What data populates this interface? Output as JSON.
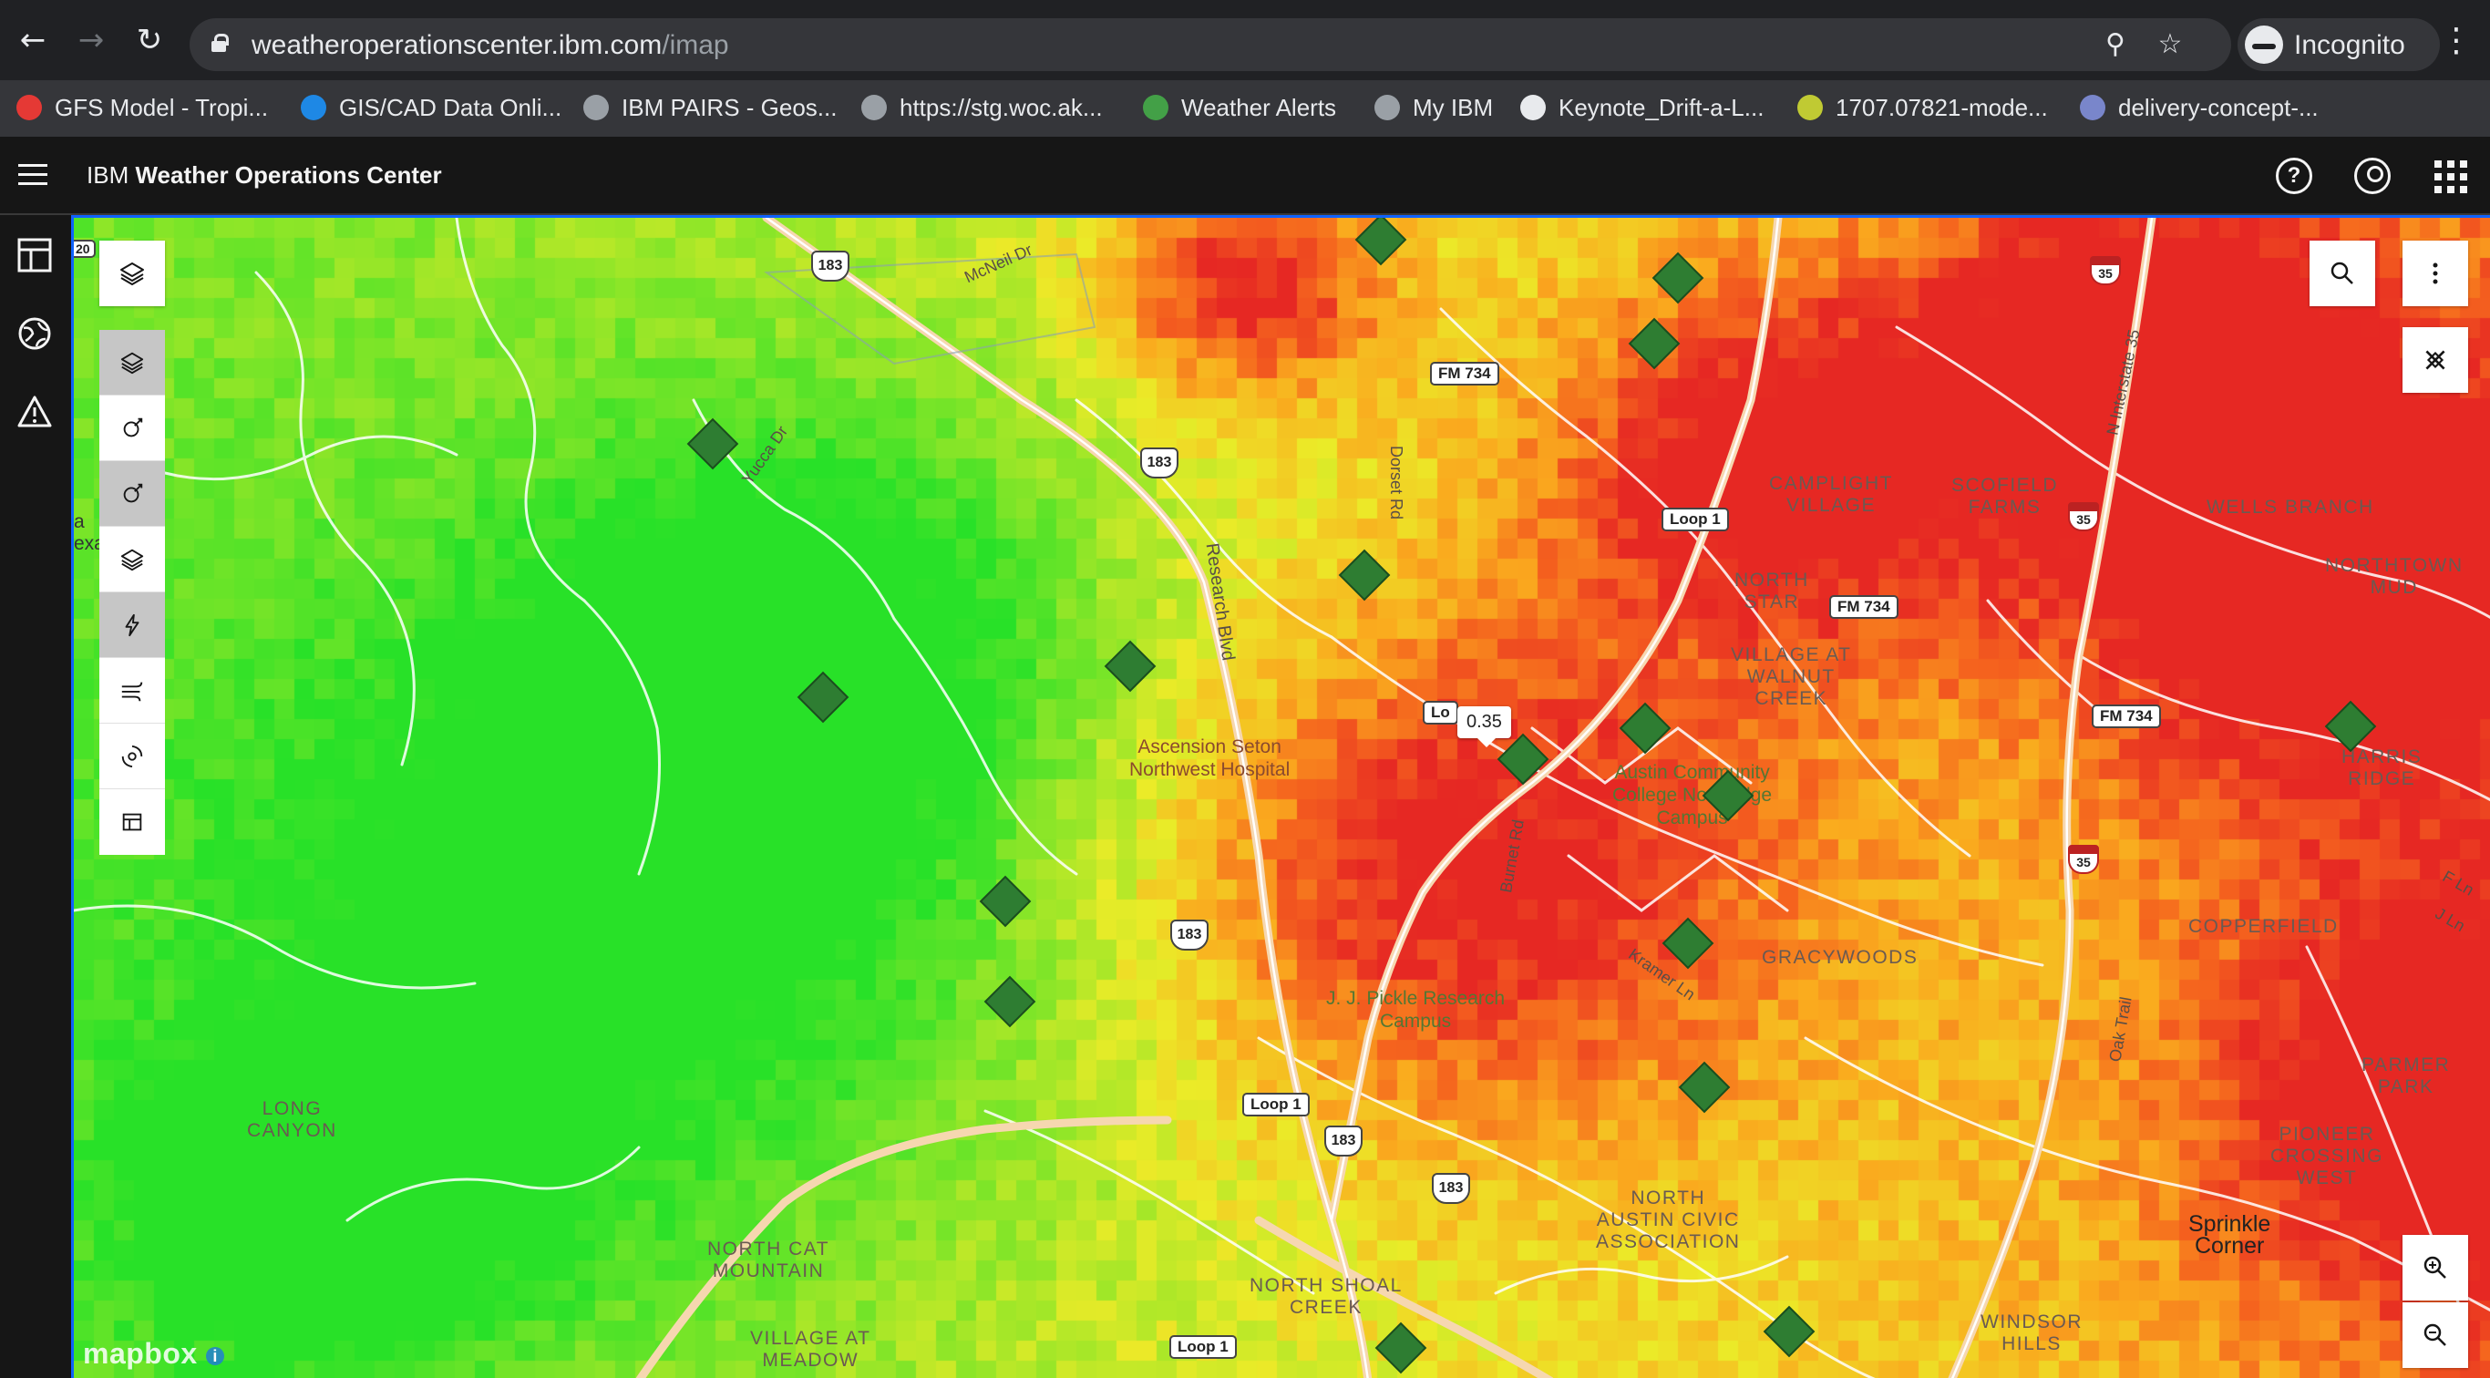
{
  "browser": {
    "url_host": "weatheroperationscenter.ibm.com",
    "url_path": "/imap",
    "profile_label": "Incognito"
  },
  "bookmarks": [
    {
      "label": "GFS Model - Tropi...",
      "color": "#e53935"
    },
    {
      "label": "GIS/CAD Data Onli...",
      "color": "#1e88e5"
    },
    {
      "label": "IBM PAIRS - Geos...",
      "color": "#9aa0a6"
    },
    {
      "label": "https://stg.woc.ak...",
      "color": "#9aa0a6"
    },
    {
      "label": "Weather Alerts",
      "color": "#43a047"
    },
    {
      "label": "My IBM",
      "color": "#9aa0a6"
    },
    {
      "label": "Keynote_Drift-a-L...",
      "color": "#e8eaed"
    },
    {
      "label": "1707.07821-mode...",
      "color": "#c0ca33"
    },
    {
      "label": "delivery-concept-...",
      "color": "#7986cb"
    }
  ],
  "app": {
    "brand": "IBM",
    "title": "Weather Operations Center"
  },
  "map": {
    "tooltip_value": "0.35",
    "attribution": "mapbox",
    "area_labels": [
      {
        "text": "LONG\nCANYON"
      },
      {
        "text": "NORTH CAT\nMOUNTAIN"
      },
      {
        "text": "VILLAGE AT\nMEADOW"
      },
      {
        "text": "CAMPLIGHT\nVILLAGE"
      },
      {
        "text": "SCOFIELD\nFARMS"
      },
      {
        "text": "NORTH\nSTAR"
      },
      {
        "text": "VILLAGE AT\nWALNUT\nCREEK"
      },
      {
        "text": "GRACYWOODS"
      },
      {
        "text": "COPPERFIELD"
      },
      {
        "text": "HARRIS\nRIDGE"
      },
      {
        "text": "PARMER\nPARK"
      },
      {
        "text": "PIONEER\nCROSSING\nWEST"
      },
      {
        "text": "NORTH\nAUSTIN CIVIC\nASSOCIATION"
      },
      {
        "text": "NORTH SHOAL\nCREEK"
      },
      {
        "text": "WINDSOR\nHILLS"
      },
      {
        "text": "WELLS BRANCH"
      },
      {
        "text": "NORTHTOWN\nMUD"
      }
    ],
    "place_labels": [
      {
        "text": "Sprinkle\nCorner"
      }
    ],
    "pois": [
      {
        "text": "Ascension Seton\nNorthwest Hospital"
      },
      {
        "text": "Austin Community\nCollege Northridge\nCampus"
      },
      {
        "text": "J. J. Pickle Research\nCampus"
      }
    ],
    "roads": [
      {
        "text": "McNeil Dr"
      },
      {
        "text": "Yucca Dr"
      },
      {
        "text": "Dorset Rd"
      },
      {
        "text": "Research Blvd"
      },
      {
        "text": "Burnet Rd"
      },
      {
        "text": "Kramer Ln"
      },
      {
        "text": "N Interstate 35"
      },
      {
        "text": "Oak Trail"
      },
      {
        "text": "F Ln"
      },
      {
        "text": "J Ln"
      }
    ],
    "shields": {
      "hw183": "183",
      "fm734": "FM 734",
      "loop1": "Loop 1",
      "i35": "35",
      "loop_partial": "Lo"
    },
    "edge_labels": {
      "left_a": "a",
      "left_exa": "exa",
      "topleft": "20"
    }
  }
}
